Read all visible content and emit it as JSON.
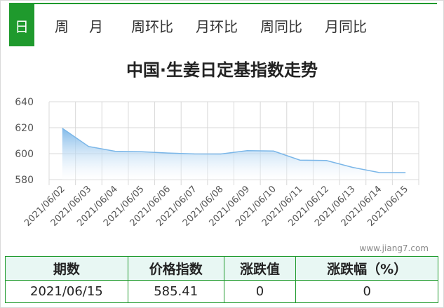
{
  "tabs": [
    {
      "label": "日",
      "active": true
    },
    {
      "label": "周",
      "active": false
    },
    {
      "label": "月",
      "active": false
    },
    {
      "label": "周环比",
      "active": false
    },
    {
      "label": "月环比",
      "active": false
    },
    {
      "label": "周同比",
      "active": false
    },
    {
      "label": "月同比",
      "active": false
    }
  ],
  "colors": {
    "accent": "#1f9a2d",
    "line": "#7ab6e8",
    "header_bg": "#e8f7f3"
  },
  "chart_data": {
    "type": "area",
    "title": "中国·生姜日定基指数走势",
    "categories": [
      "2021/06/02",
      "2021/06/03",
      "2021/06/04",
      "2021/06/05",
      "2021/06/06",
      "2021/06/07",
      "2021/06/08",
      "2021/06/09",
      "2021/06/10",
      "2021/06/11",
      "2021/06/12",
      "2021/06/13",
      "2021/06/14",
      "2021/06/15"
    ],
    "values": [
      619.5,
      605.5,
      601.8,
      601.5,
      600.5,
      599.8,
      599.7,
      602.3,
      602.0,
      595.0,
      594.7,
      589.4,
      585.5,
      585.4
    ],
    "ylim": [
      580,
      640
    ],
    "yticks": [
      580,
      600,
      620,
      640
    ],
    "grid": true,
    "xlabel": "",
    "ylabel": ""
  },
  "watermark": "www.jiang7.com",
  "table": {
    "headers": [
      "期数",
      "价格指数",
      "涨跌值",
      "涨跌幅（%）"
    ],
    "rows": [
      [
        "2021/06/15",
        "585.41",
        "0",
        "0"
      ]
    ]
  }
}
